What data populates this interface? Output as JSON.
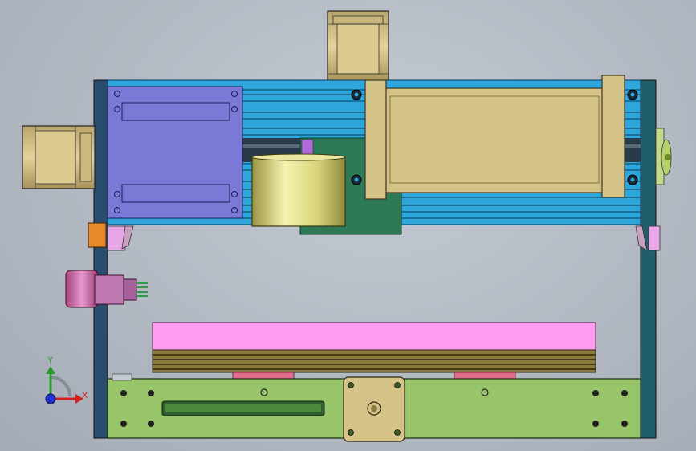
{
  "viewport": {
    "background": "#b8bec6",
    "colors": {
      "frame_blue": "#2ea6dc",
      "carriage_purple": "#7b79d6",
      "bed_pink": "#ff9cf0",
      "base_green": "#98c46a",
      "motor_tan": "#d6c387",
      "cylinder_gold": "#d8d47a",
      "side_plate_navy": "#2a4d6e",
      "side_plate_teal": "#1f5e6a",
      "orange_block": "#e88a2a",
      "dark_green": "#2e7a56"
    }
  },
  "triad": {
    "x_label": "X",
    "y_label": "Y",
    "x_color": "#d02020",
    "y_color": "#2a9a2a",
    "z_color": "#1f2fd0"
  },
  "parts": {
    "top_stepper_motor": "stepper-motor-icon",
    "left_stepper_motor": "stepper-motor-icon",
    "bottom_stepper_motor": "stepper-motor-icon",
    "spindle_cylinder": "cylinder-icon",
    "aviation_connector": "connector-icon"
  }
}
